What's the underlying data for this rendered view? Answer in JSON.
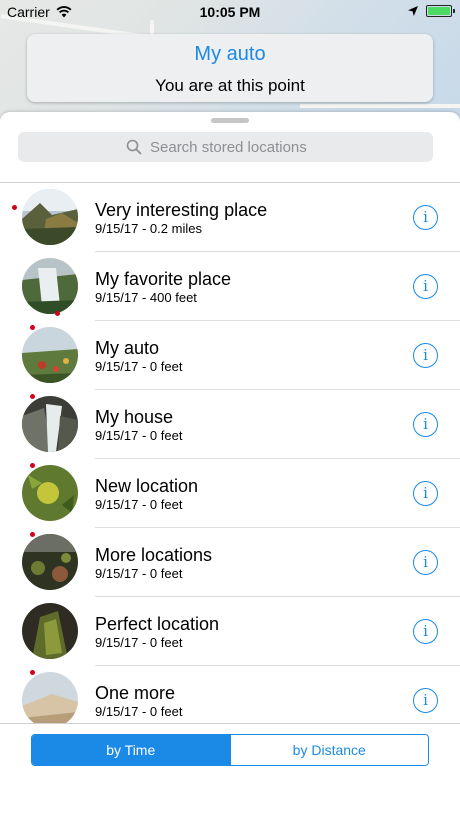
{
  "status_bar": {
    "carrier": "Carrier",
    "time": "10:05 PM"
  },
  "callout": {
    "title": "My auto",
    "subtitle": "You are at this point"
  },
  "search": {
    "placeholder": "Search stored locations",
    "value": ""
  },
  "locations": [
    {
      "title": "Very interesting place",
      "subtitle": "9/15/17 - 0.2 miles",
      "thumbnail": "seascape-cliff-photo",
      "has_red_dot": true
    },
    {
      "title": "My favorite place",
      "subtitle": "9/15/17 - 400 feet",
      "thumbnail": "waterfall-photo",
      "has_red_dot": true
    },
    {
      "title": "My auto",
      "subtitle": "9/15/17 - 0 feet",
      "thumbnail": "meadow-flowers-photo",
      "has_red_dot": true
    },
    {
      "title": "My house",
      "subtitle": "9/15/17 - 0 feet",
      "thumbnail": "rock-stream-photo",
      "has_red_dot": true
    },
    {
      "title": "New location",
      "subtitle": "9/15/17 - 0 feet",
      "thumbnail": "green-fruit-photo",
      "has_red_dot": true
    },
    {
      "title": "More locations",
      "subtitle": "9/15/17 - 0 feet",
      "thumbnail": "dark-plants-photo",
      "has_red_dot": true
    },
    {
      "title": "Perfect location",
      "subtitle": "9/15/17 - 0 feet",
      "thumbnail": "mossy-rock-photo",
      "has_red_dot": false
    },
    {
      "title": "One more",
      "subtitle": "9/15/17 - 0 feet",
      "thumbnail": "sand-dune-photo",
      "has_red_dot": true
    }
  ],
  "sort_control": {
    "options": [
      "by Time",
      "by Distance"
    ],
    "selected": "by Time"
  },
  "colors": {
    "accent": "#1a8ae6",
    "marker": "#d0021b",
    "battery": "#4cd964"
  }
}
